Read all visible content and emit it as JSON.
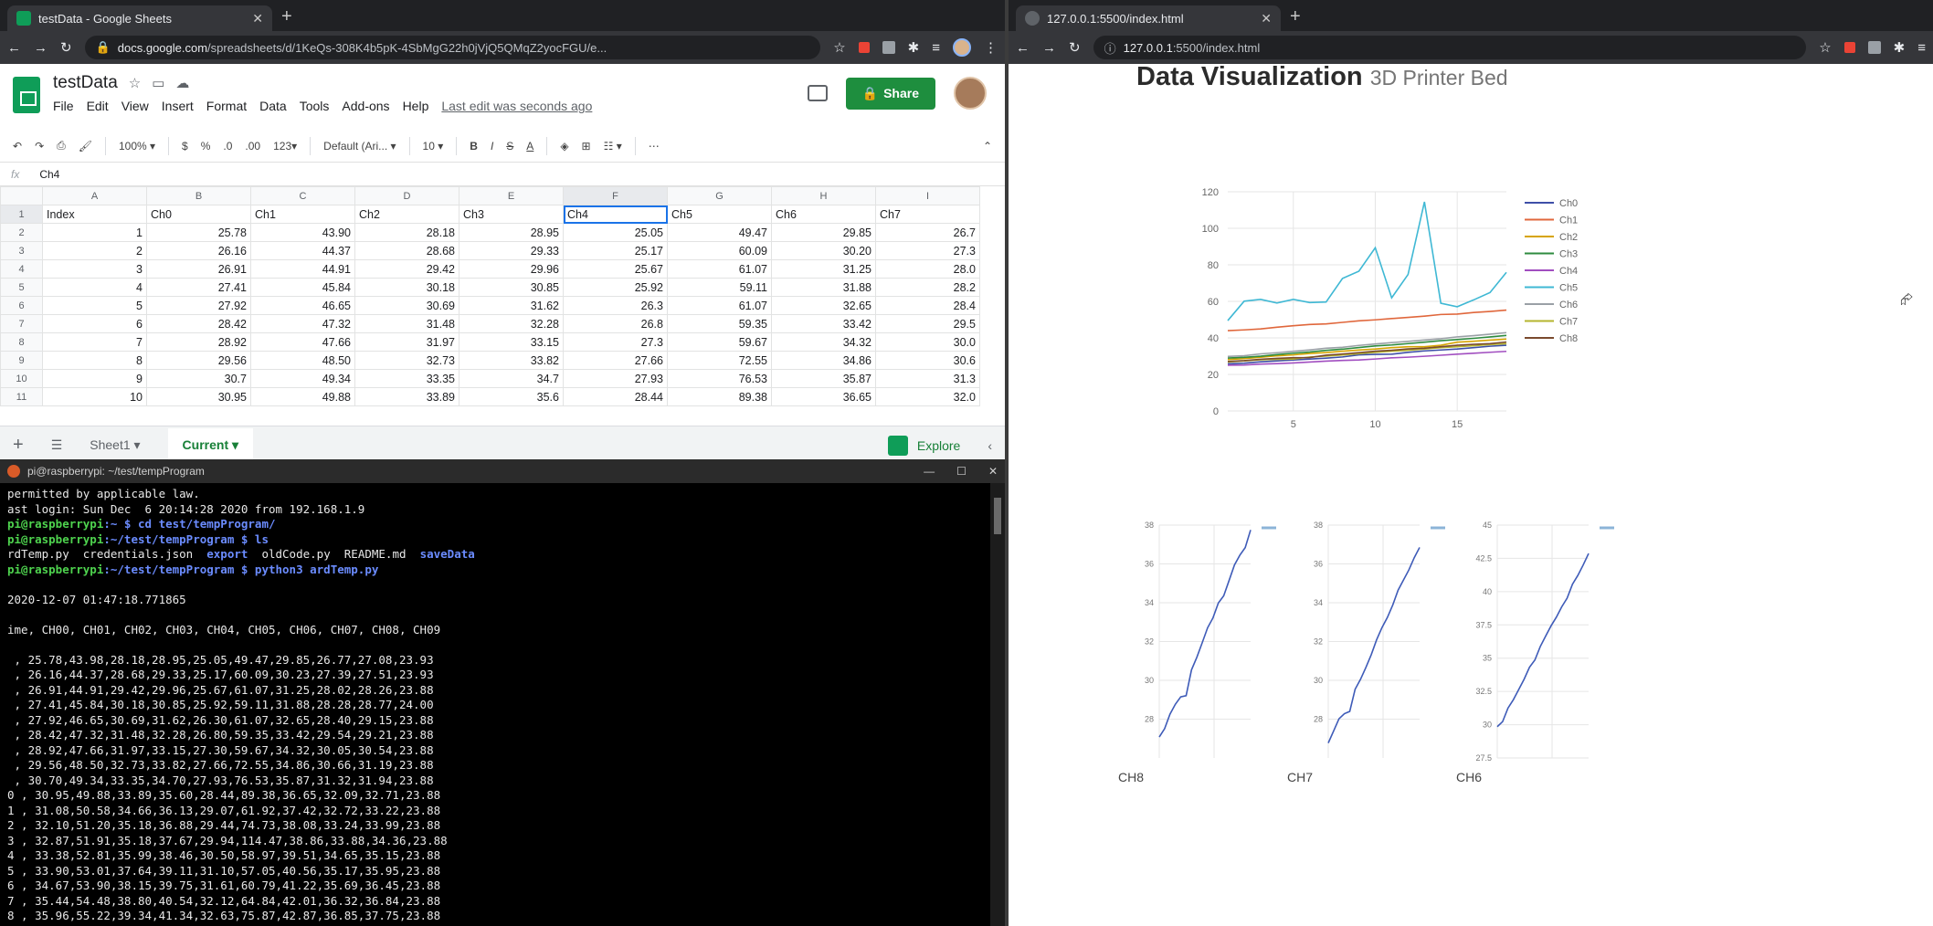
{
  "left_browser": {
    "tab": {
      "title": "testData - Google Sheets",
      "favicon_color": "#0f9d58"
    },
    "url_host": "docs.google.com",
    "url_path": "/spreadsheets/d/1KeQs-308K4b5pK-4SbMgG22h0jVjQ5QMqZ2yocFGU/e...",
    "sheet": {
      "title": "testData",
      "menus": [
        "File",
        "Edit",
        "View",
        "Insert",
        "Format",
        "Data",
        "Tools",
        "Add-ons",
        "Help"
      ],
      "last_edit": "Last edit was seconds ago",
      "share_label": "Share",
      "toolbar": {
        "zoom": "100%",
        "currency": "$",
        "percent": "%",
        "dec_less": ".0",
        "dec_more": ".00",
        "more_formats": "123",
        "font": "Default (Ari...",
        "font_size": "10"
      },
      "formula_cell_value": "Ch4",
      "column_letters": [
        "A",
        "B",
        "C",
        "D",
        "E",
        "F",
        "G",
        "H",
        "I"
      ],
      "header_row": [
        "Index",
        "Ch0",
        "Ch1",
        "Ch2",
        "Ch3",
        "Ch4",
        "Ch5",
        "Ch6",
        "Ch7"
      ],
      "rows": [
        [
          "1",
          "25.78",
          "43.90",
          "28.18",
          "28.95",
          "25.05",
          "49.47",
          "29.85",
          "26.7"
        ],
        [
          "2",
          "26.16",
          "44.37",
          "28.68",
          "29.33",
          "25.17",
          "60.09",
          "30.20",
          "27.3"
        ],
        [
          "3",
          "26.91",
          "44.91",
          "29.42",
          "29.96",
          "25.67",
          "61.07",
          "31.25",
          "28.0"
        ],
        [
          "4",
          "27.41",
          "45.84",
          "30.18",
          "30.85",
          "25.92",
          "59.11",
          "31.88",
          "28.2"
        ],
        [
          "5",
          "27.92",
          "46.65",
          "30.69",
          "31.62",
          "26.3",
          "61.07",
          "32.65",
          "28.4"
        ],
        [
          "6",
          "28.42",
          "47.32",
          "31.48",
          "32.28",
          "26.8",
          "59.35",
          "33.42",
          "29.5"
        ],
        [
          "7",
          "28.92",
          "47.66",
          "31.97",
          "33.15",
          "27.3",
          "59.67",
          "34.32",
          "30.0"
        ],
        [
          "8",
          "29.56",
          "48.50",
          "32.73",
          "33.82",
          "27.66",
          "72.55",
          "34.86",
          "30.6"
        ],
        [
          "9",
          "30.7",
          "49.34",
          "33.35",
          "34.7",
          "27.93",
          "76.53",
          "35.87",
          "31.3"
        ],
        [
          "10",
          "30.95",
          "49.88",
          "33.89",
          "35.6",
          "28.44",
          "89.38",
          "36.65",
          "32.0"
        ]
      ],
      "sheet_tabs": [
        "Sheet1",
        "Current"
      ],
      "explore_label": "Explore"
    }
  },
  "terminal": {
    "title": "pi@raspberrypi: ~/test/tempProgram",
    "intro_lines": [
      "permitted by applicable law.",
      "ast login: Sun Dec  6 20:14:28 2020 from 192.168.1.9"
    ],
    "prompt_user": "pi@raspberrypi",
    "cmd1": ":~ $ cd test/tempProgram/",
    "prompt_path": ":~/test/tempProgram $ ls",
    "ls_plain": "rdTemp.py  credentials.json  ",
    "ls_export": "export",
    "ls_mid": "  oldCode.py  README.md  ",
    "ls_save": "saveData",
    "cmd3": ":~/test/tempProgram $ python3 ardTemp.py",
    "timestamp": "2020-12-07 01:47:18.771865",
    "columns": "ime, CH00, CH01, CH02, CH03, CH04, CH05, CH06, CH07, CH08, CH09",
    "data_lines": [
      " , 25.78,43.98,28.18,28.95,25.05,49.47,29.85,26.77,27.08,23.93",
      " , 26.16,44.37,28.68,29.33,25.17,60.09,30.23,27.39,27.51,23.93",
      " , 26.91,44.91,29.42,29.96,25.67,61.07,31.25,28.02,28.26,23.88",
      " , 27.41,45.84,30.18,30.85,25.92,59.11,31.88,28.28,28.77,24.00",
      " , 27.92,46.65,30.69,31.62,26.30,61.07,32.65,28.40,29.15,23.88",
      " , 28.42,47.32,31.48,32.28,26.80,59.35,33.42,29.54,29.21,23.88",
      " , 28.92,47.66,31.97,33.15,27.30,59.67,34.32,30.05,30.54,23.88",
      " , 29.56,48.50,32.73,33.82,27.66,72.55,34.86,30.66,31.19,23.88",
      " , 30.70,49.34,33.35,34.70,27.93,76.53,35.87,31.32,31.94,23.88",
      "0 , 30.95,49.88,33.89,35.60,28.44,89.38,36.65,32.09,32.71,23.88",
      "1 , 31.08,50.58,34.66,36.13,29.07,61.92,37.42,32.72,33.22,23.88",
      "2 , 32.10,51.20,35.18,36.88,29.44,74.73,38.08,33.24,33.99,23.88",
      "3 , 32.87,51.91,35.18,37.67,29.94,114.47,38.86,33.88,34.36,23.88",
      "4 , 33.38,52.81,35.99,38.46,30.50,58.97,39.51,34.65,35.15,23.88",
      "5 , 33.90,53.01,37.64,39.11,31.10,57.05,40.56,35.17,35.95,23.88",
      "6 , 34.67,53.90,38.15,39.75,31.61,60.79,41.22,35.69,36.45,23.88",
      "7 , 35.44,54.48,38.80,40.54,32.12,64.84,42.01,36.32,36.84,23.88",
      "8 , 35.96,55.22,39.34,41.34,32.63,75.87,42.87,36.85,37.75,23.88"
    ]
  },
  "right_browser": {
    "tab": {
      "title": "127.0.0.1:5500/index.html"
    },
    "url_host": "127.0.0.1",
    "url_path": ":5500/index.html",
    "heading": "Data Visualization",
    "subheading": "3D Printer Bed",
    "small_chart_labels": [
      "CH8",
      "CH7",
      "CH6"
    ]
  },
  "colors": {
    "Ch0": "#3e4fa8",
    "Ch1": "#e0673c",
    "Ch2": "#d6a400",
    "Ch3": "#2e8b3f",
    "Ch4": "#a14ec0",
    "Ch5": "#3fb8d4",
    "Ch6": "#9aa0a6",
    "Ch7": "#b5b52e",
    "Ch8": "#7a4a2e"
  },
  "chart_data": [
    {
      "type": "line",
      "x": [
        1,
        2,
        3,
        4,
        5,
        6,
        7,
        8,
        9,
        10,
        11,
        12,
        13,
        14,
        15,
        16,
        17,
        18
      ],
      "ylim": [
        0,
        120
      ],
      "yticks": [
        0,
        20,
        40,
        60,
        80,
        100,
        120
      ],
      "xticks": [
        5,
        10,
        15
      ],
      "legend": "right",
      "grid": true,
      "series": [
        {
          "name": "Ch0",
          "values": [
            25.78,
            26.16,
            26.91,
            27.41,
            27.92,
            28.42,
            28.92,
            29.56,
            30.7,
            30.95,
            31.08,
            32.1,
            32.87,
            33.38,
            33.9,
            34.67,
            35.44,
            35.96
          ]
        },
        {
          "name": "Ch1",
          "values": [
            43.98,
            44.37,
            44.91,
            45.84,
            46.65,
            47.32,
            47.66,
            48.5,
            49.34,
            49.88,
            50.58,
            51.2,
            51.91,
            52.81,
            53.01,
            53.9,
            54.48,
            55.22
          ]
        },
        {
          "name": "Ch2",
          "values": [
            28.18,
            28.68,
            29.42,
            30.18,
            30.69,
            31.48,
            31.97,
            32.73,
            33.35,
            33.89,
            34.66,
            35.18,
            35.18,
            35.99,
            37.64,
            38.15,
            38.8,
            39.34
          ]
        },
        {
          "name": "Ch3",
          "values": [
            28.95,
            29.33,
            29.96,
            30.85,
            31.62,
            32.28,
            33.15,
            33.82,
            34.7,
            35.6,
            36.13,
            36.88,
            37.67,
            38.46,
            39.11,
            39.75,
            40.54,
            41.34
          ]
        },
        {
          "name": "Ch4",
          "values": [
            25.05,
            25.17,
            25.67,
            25.92,
            26.3,
            26.8,
            27.3,
            27.66,
            27.93,
            28.44,
            29.07,
            29.44,
            29.94,
            30.5,
            31.1,
            31.61,
            32.12,
            32.63
          ]
        },
        {
          "name": "Ch5",
          "values": [
            49.47,
            60.09,
            61.07,
            59.11,
            61.07,
            59.35,
            59.67,
            72.55,
            76.53,
            89.38,
            61.92,
            74.73,
            114.47,
            58.97,
            57.05,
            60.79,
            64.84,
            75.87
          ]
        },
        {
          "name": "Ch6",
          "values": [
            29.85,
            30.23,
            31.25,
            31.88,
            32.65,
            33.42,
            34.32,
            34.86,
            35.87,
            36.65,
            37.42,
            38.08,
            38.86,
            39.51,
            40.56,
            41.22,
            42.01,
            42.87
          ]
        },
        {
          "name": "Ch7",
          "values": [
            26.77,
            27.39,
            28.02,
            28.28,
            28.4,
            29.54,
            30.05,
            30.66,
            31.32,
            32.09,
            32.72,
            33.24,
            33.88,
            34.65,
            35.17,
            35.69,
            36.32,
            36.85
          ]
        },
        {
          "name": "Ch8",
          "values": [
            27.08,
            27.51,
            28.26,
            28.77,
            29.15,
            29.21,
            30.54,
            31.19,
            31.94,
            32.71,
            33.22,
            33.99,
            34.36,
            35.15,
            35.95,
            36.45,
            36.84,
            37.75
          ]
        }
      ]
    },
    {
      "type": "line",
      "xlabel": "CH8",
      "ylim": [
        26,
        38
      ],
      "yticks": [
        28,
        30,
        32,
        34,
        36,
        38
      ],
      "series": [
        {
          "values": [
            27.08,
            27.51,
            28.26,
            28.77,
            29.15,
            29.21,
            30.54,
            31.19,
            31.94,
            32.71,
            33.22,
            33.99,
            34.36,
            35.15,
            35.95,
            36.45,
            36.84,
            37.75
          ]
        }
      ]
    },
    {
      "type": "line",
      "xlabel": "CH7",
      "ylim": [
        26,
        38
      ],
      "yticks": [
        28,
        30,
        32,
        34,
        36,
        38
      ],
      "series": [
        {
          "values": [
            26.77,
            27.39,
            28.02,
            28.28,
            28.4,
            29.54,
            30.05,
            30.66,
            31.32,
            32.09,
            32.72,
            33.24,
            33.88,
            34.65,
            35.17,
            35.69,
            36.32,
            36.85
          ]
        }
      ]
    },
    {
      "type": "line",
      "xlabel": "CH6",
      "ylim": [
        27.5,
        45.0
      ],
      "yticks": [
        27.5,
        30.0,
        32.5,
        35.0,
        37.5,
        40.0,
        42.5,
        45.0
      ],
      "series": [
        {
          "values": [
            29.85,
            30.23,
            31.25,
            31.88,
            32.65,
            33.42,
            34.32,
            34.86,
            35.87,
            36.65,
            37.42,
            38.08,
            38.86,
            39.51,
            40.56,
            41.22,
            42.01,
            42.87
          ]
        }
      ]
    }
  ]
}
